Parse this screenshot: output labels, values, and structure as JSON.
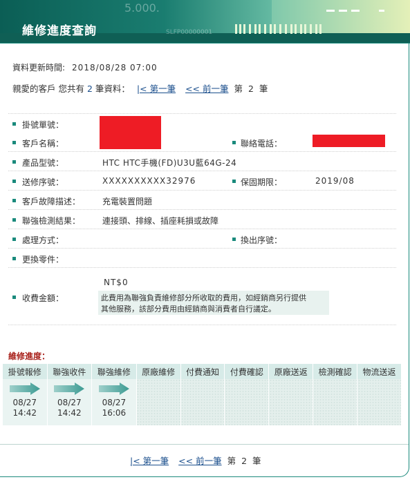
{
  "header": {
    "title": "維修進度查詢",
    "decor_text": "5.000.",
    "decor_text2": "SLFP00000001"
  },
  "update": {
    "label": "資料更新時間:",
    "value": "2018/08/28 07:00"
  },
  "records": {
    "prefix": "親愛的客戶 您共有",
    "count": "2",
    "suffix": "筆資料：",
    "first": "|< 第一筆",
    "prev": "<< 前一筆",
    "page_prefix": "第",
    "page": "2",
    "page_suffix": "筆"
  },
  "fields": {
    "case_no": {
      "label": "掛號單號："
    },
    "customer_name": {
      "label": "客戶名稱："
    },
    "phone": {
      "label": "聯絡電話："
    },
    "model": {
      "label": "產品型號：",
      "value": "HTC HTC手機(FD)U3U藍64G-24"
    },
    "serial": {
      "label": "送修序號：",
      "value": "XXXXXXXXXX32976"
    },
    "warranty": {
      "label": "保固期限：",
      "value": "2019/08"
    },
    "fault": {
      "label": "客戶故障描述：",
      "value": "充電裝置問題"
    },
    "inspection": {
      "label": "聯強檢測結果：",
      "value": "連接頭、排線、插座耗損或故障"
    },
    "handling": {
      "label": "處理方式："
    },
    "replace_serial": {
      "label": "換出序號："
    },
    "parts": {
      "label": "更換零件："
    },
    "fee": {
      "label": "收費金額：",
      "value": "NT$0",
      "note_line1": "此費用為聯強負責維修部分所收取的費用，如經銷商另行提供",
      "note_line2": "其他服務，該部分費用由經銷商與消費者自行議定。"
    }
  },
  "progress": {
    "title": "維修進度：",
    "steps": [
      {
        "label": "掛號報修",
        "date": "08/27",
        "time": "14:42"
      },
      {
        "label": "聯強收件",
        "date": "08/27",
        "time": "14:42"
      },
      {
        "label": "聯強維修",
        "date": "08/27",
        "time": "16:06"
      },
      {
        "label": "原廠維修"
      },
      {
        "label": "付費通知"
      },
      {
        "label": "付費確認"
      },
      {
        "label": "原廠送返"
      },
      {
        "label": "檢測確認"
      },
      {
        "label": "物流送返"
      }
    ]
  },
  "colors": {
    "accent": "#1a8a7c",
    "header_dark": "#0b5e55",
    "link": "#1a4e8c",
    "redact": "#ee1c25",
    "progress_title": "#a8201a"
  }
}
